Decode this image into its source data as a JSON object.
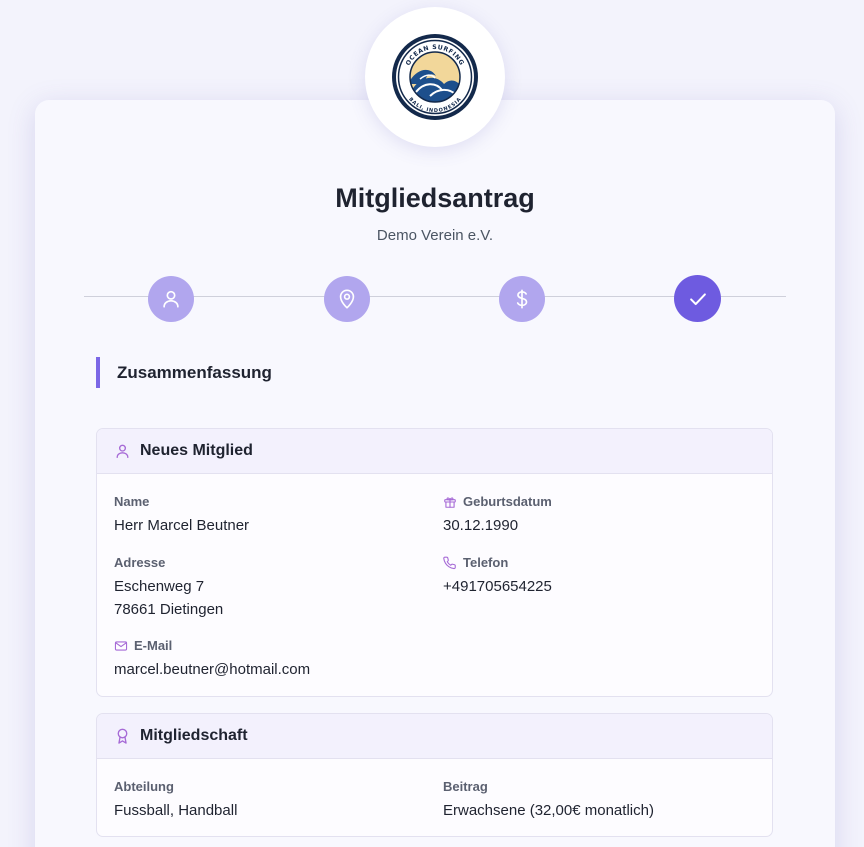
{
  "logo": {
    "top_text": "OCEAN SURFING",
    "bottom_text": "BALI, INDONESIA"
  },
  "header": {
    "title": "Mitgliedsantrag",
    "subtitle": "Demo Verein e.V."
  },
  "stepper": {
    "steps": [
      {
        "icon": "user-icon",
        "state": "done"
      },
      {
        "icon": "map-pin-icon",
        "state": "done"
      },
      {
        "icon": "dollar-icon",
        "state": "done"
      },
      {
        "icon": "check-icon",
        "state": "active"
      }
    ]
  },
  "section": {
    "title": "Zusammenfassung"
  },
  "member_panel": {
    "title": "Neues Mitglied",
    "icon": "user-icon",
    "name_label": "Name",
    "name_value": "Herr Marcel Beutner",
    "birth_label": "Geburtsdatum",
    "birth_value": "30.12.1990",
    "address_label": "Adresse",
    "address_line1": "Eschenweg 7",
    "address_line2": "78661 Dietingen",
    "phone_label": "Telefon",
    "phone_value": "+491705654225",
    "email_label": "E-Mail",
    "email_value": "marcel.beutner@hotmail.com"
  },
  "membership_panel": {
    "title": "Mitgliedschaft",
    "icon": "award-icon",
    "department_label": "Abteilung",
    "department_value": "Fussball, Handball",
    "fee_label": "Beitrag",
    "fee_value": "Erwachsene (32,00€ monatlich)"
  },
  "colors": {
    "accent": "#6e5be0",
    "accent_light": "#b1a6ee",
    "icon_tint": "#a66ad6",
    "background": "#f3f3fc"
  }
}
